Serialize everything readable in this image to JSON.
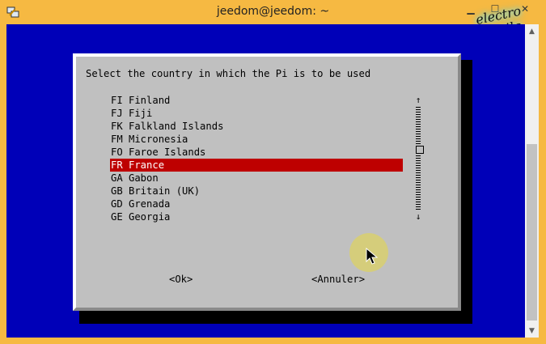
{
  "window": {
    "title": "jeedom@jeedom: ~"
  },
  "icons": {
    "app": "putty-icon",
    "minimize": "minimize-icon",
    "maximize": "maximize-icon",
    "close": "close-icon"
  },
  "logo": {
    "line1": "electro",
    "line2": "toile"
  },
  "dialog": {
    "prompt": "Select the country in which the Pi is to be used",
    "items": [
      "FI Finland",
      "FJ Fiji",
      "FK Falkland Islands",
      "FM Micronesia",
      "FO Faroe Islands",
      "FR France",
      "GA Gabon",
      "GB Britain (UK)",
      "GD Grenada",
      "GE Georgia"
    ],
    "selected_index": 5,
    "ok_label": "<Ok>",
    "cancel_label": "<Annuler>",
    "scroll_up": "↑",
    "scroll_down": "↓"
  },
  "colors": {
    "terminal_bg": "#0000b8",
    "dialog_bg": "#c0c0c0",
    "selection": "#be0000",
    "frame": "#f6b942"
  }
}
